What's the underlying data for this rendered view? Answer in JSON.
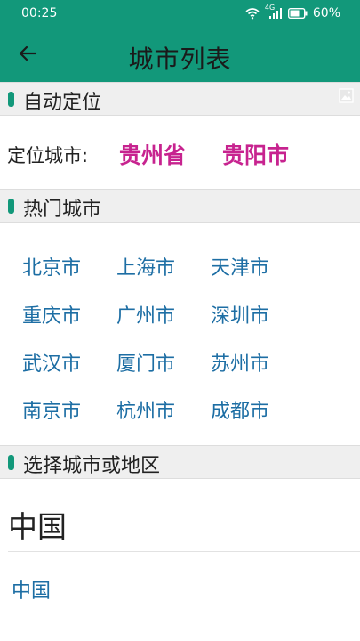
{
  "status_bar": {
    "time": "00:25",
    "network": "4G",
    "battery": "60%",
    "icons": [
      "wifi-icon",
      "signal-icon",
      "battery-icon"
    ]
  },
  "toolbar": {
    "back_icon": "arrow-left-icon",
    "title": "城市列表"
  },
  "sections": {
    "auto_locate": {
      "title": "自动定位",
      "corner_icon": "image-placeholder-icon"
    },
    "hot_cities": {
      "title": "热门城市"
    },
    "select_region": {
      "title": "选择城市或地区"
    }
  },
  "location": {
    "label": "定位城市:",
    "province": "贵州省",
    "city": "贵阳市"
  },
  "hot_cities": [
    "北京市",
    "上海市",
    "天津市",
    "重庆市",
    "广州市",
    "深圳市",
    "武汉市",
    "厦门市",
    "苏州市",
    "南京市",
    "杭州市",
    "成都市"
  ],
  "region_list": {
    "group_title": "中国",
    "items": [
      "中国"
    ]
  },
  "colors": {
    "accent": "#12987a",
    "highlight": "#c7238f",
    "link": "#1d6ea4",
    "section_bg": "#efefef"
  }
}
